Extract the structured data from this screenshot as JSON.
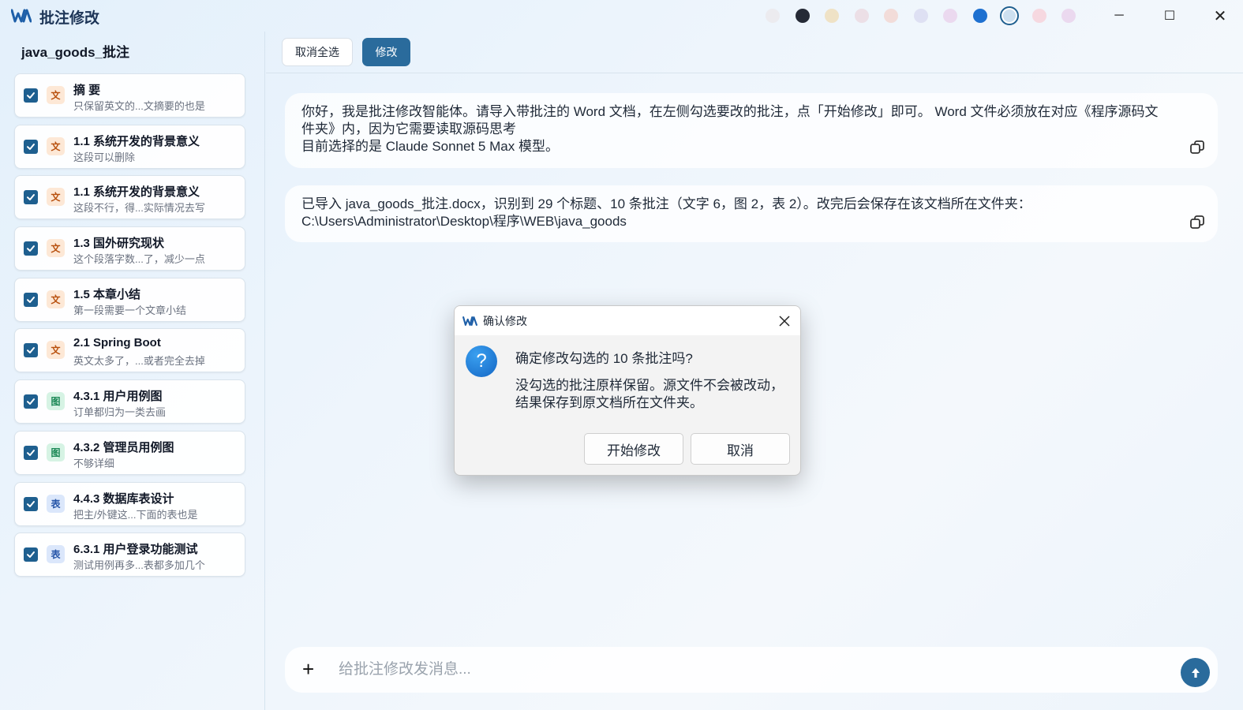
{
  "app": {
    "title": "批注修改",
    "theme_swatches": [
      "#ecebef",
      "#252a36",
      "#efe2c6",
      "#ecdfe6",
      "#f2dcd9",
      "#dee0f3",
      "#ebd9ef",
      "#1e70d0",
      "#cde0f0",
      "#f6d8e0",
      "#ebd9ef"
    ],
    "selected_swatch_index": 8
  },
  "window_controls": {
    "minimize": "─",
    "maximize": "☐",
    "close": "✕"
  },
  "sidebar": {
    "title": "java_goods_批注",
    "items": [
      {
        "type": "text",
        "tag": "文",
        "title": "摘 要",
        "subtitle": "只保留英文的...文摘要的也是",
        "checked": true
      },
      {
        "type": "text",
        "tag": "文",
        "title": "1.1 系统开发的背景意义",
        "subtitle": "这段可以删除",
        "checked": true
      },
      {
        "type": "text",
        "tag": "文",
        "title": "1.1 系统开发的背景意义",
        "subtitle": "这段不行，得...实际情况去写",
        "checked": true
      },
      {
        "type": "text",
        "tag": "文",
        "title": "1.3 国外研究现状",
        "subtitle": "这个段落字数...了，减少一点",
        "checked": true
      },
      {
        "type": "text",
        "tag": "文",
        "title": "1.5 本章小结",
        "subtitle": "第一段需要一个文章小结",
        "checked": true
      },
      {
        "type": "text",
        "tag": "文",
        "title": "2.1 Spring Boot",
        "subtitle": "英文太多了，...或者完全去掉",
        "checked": true
      },
      {
        "type": "image",
        "tag": "图",
        "title": "4.3.1 用户用例图",
        "subtitle": "订单都归为一类去画",
        "checked": true
      },
      {
        "type": "image",
        "tag": "图",
        "title": "4.3.2 管理员用例图",
        "subtitle": "不够详细",
        "checked": true
      },
      {
        "type": "table",
        "tag": "表",
        "title": "4.4.3 数据库表设计",
        "subtitle": "把主/外键这...下面的表也是",
        "checked": true
      },
      {
        "type": "table",
        "tag": "表",
        "title": "6.3.1 用户登录功能测试",
        "subtitle": "测试用例再多...表都多加几个",
        "checked": true
      }
    ]
  },
  "toolbar": {
    "deselect_all_label": "取消全选",
    "modify_label": "修改"
  },
  "messages": [
    {
      "text": "你好，我是批注修改智能体。请导入带批注的 Word 文档，在左侧勾选要改的批注，点「开始修改」即可。 Word 文件必须放在对应《程序源码文件夹》内，因为它需要读取源码思考\n目前选择的是 Claude Sonnet 5 Max 模型。"
    },
    {
      "text": "已导入 java_goods_批注.docx，识别到 29 个标题、10 条批注（文字 6，图 2，表 2）。改完后会保存在该文档所在文件夹：\nC:\\Users\\Administrator\\Desktop\\程序\\WEB\\java_goods"
    }
  ],
  "input": {
    "placeholder": "给批注修改发消息...",
    "value": "",
    "plus_label": "+"
  },
  "dialog": {
    "title": "确认修改",
    "icon_glyph": "?",
    "question": "确定修改勾选的 10 条批注吗?",
    "body": "没勾选的批注原样保留。源文件不会被改动，\n结果保存到原文档所在文件夹。",
    "start_label": "开始修改",
    "cancel_label": "取消"
  },
  "colors": {
    "accent": "#2a6b9c",
    "checkbox": "#1e5f8f",
    "tag_text_bg": "#fde8d6",
    "tag_image_bg": "#d6f3e4",
    "tag_table_bg": "#dbe7fb"
  }
}
